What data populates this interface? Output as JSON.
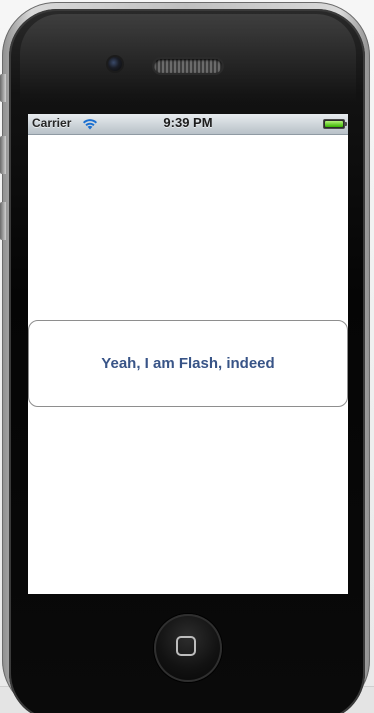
{
  "status_bar": {
    "carrier": "Carrier",
    "time": "9:39 PM",
    "wifi_icon": "wifi-icon",
    "battery_icon": "battery-icon",
    "battery_level": 1.0,
    "battery_color": "#38b400"
  },
  "main": {
    "button_label": "Yeah, I am Flash, indeed",
    "button_text_color": "#385487"
  },
  "device": {
    "home_button_icon": "home-square-icon"
  }
}
